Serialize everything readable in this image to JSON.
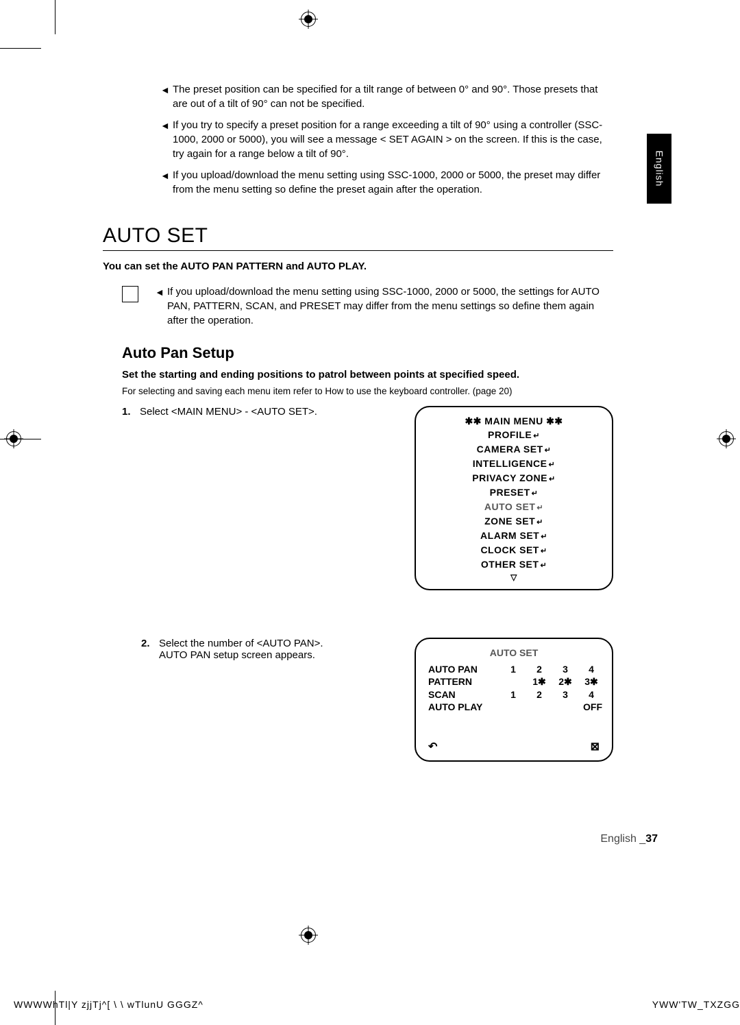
{
  "notes_top": [
    "The preset position can be specified for a tilt range of between 0° and 90°. Those presets that are out of a tilt of 90° can not be specified.",
    "If you try to specify a preset position for a range exceeding a tilt of 90° using a controller (SSC-1000, 2000 or 5000), you will see a message <  SET AGAIN  > on the screen. If this is the case, try again for a range below a tilt of 90°.",
    "If you upload/download the menu setting using SSC-1000, 2000 or 5000, the preset may differ from the menu setting so define the preset again after the operation."
  ],
  "section_title": "AUTO SET",
  "intro": "You can set the AUTO PAN PATTERN and AUTO PLAY.",
  "note_block": "If you upload/download the menu setting using SSC-1000, 2000 or 5000, the settings for AUTO PAN, PATTERN, SCAN, and PRESET may differ from the menu settings so define them again after the operation.",
  "subhead": "Auto Pan Setup",
  "sub_intro": "Set the starting and ending positions to patrol between points at specified speed.",
  "sub_small": "For selecting and saving each menu item refer to How to use the keyboard controller. (page 20)",
  "step1": {
    "num": "1.",
    "text": "Select <MAIN MENU> - <AUTO SET>."
  },
  "osd_menu": {
    "title": "✱✱ MAIN MENU ✱✱",
    "items": [
      "PROFILE",
      "CAMERA SET",
      "INTELLIGENCE",
      "PRIVACY ZONE",
      "PRESET"
    ],
    "highlight": "AUTO SET",
    "items2": [
      "ZONE SET",
      "ALARM SET",
      "CLOCK SET",
      "OTHER SET"
    ],
    "down": "▽"
  },
  "step2": {
    "num": "2.",
    "l1": "Select the number of <AUTO PAN>.",
    "l2": "AUTO PAN setup screen appears."
  },
  "osd_table": {
    "title": "AUTO SET",
    "rows": [
      {
        "lbl": "AUTO PAN",
        "vals": [
          "1",
          "2",
          "3",
          "4"
        ]
      },
      {
        "lbl": "PATTERN",
        "vals": [
          "",
          "1✱",
          "2✱",
          "3✱"
        ]
      },
      {
        "lbl": "SCAN",
        "vals": [
          "1",
          "2",
          "3",
          "4"
        ]
      },
      {
        "lbl": "AUTO PLAY",
        "vals": [
          "",
          "",
          "",
          "OFF"
        ]
      }
    ],
    "back": "↶",
    "close": "⊠"
  },
  "side_tab": "English",
  "footer_lang": "English _",
  "footer_num": "37",
  "gutter_left": "WWWWhTl|Y  zjjTj^[ \\ \\ wTlunU      GGGZ^",
  "gutter_right": "YWW'TW_TXZGG"
}
